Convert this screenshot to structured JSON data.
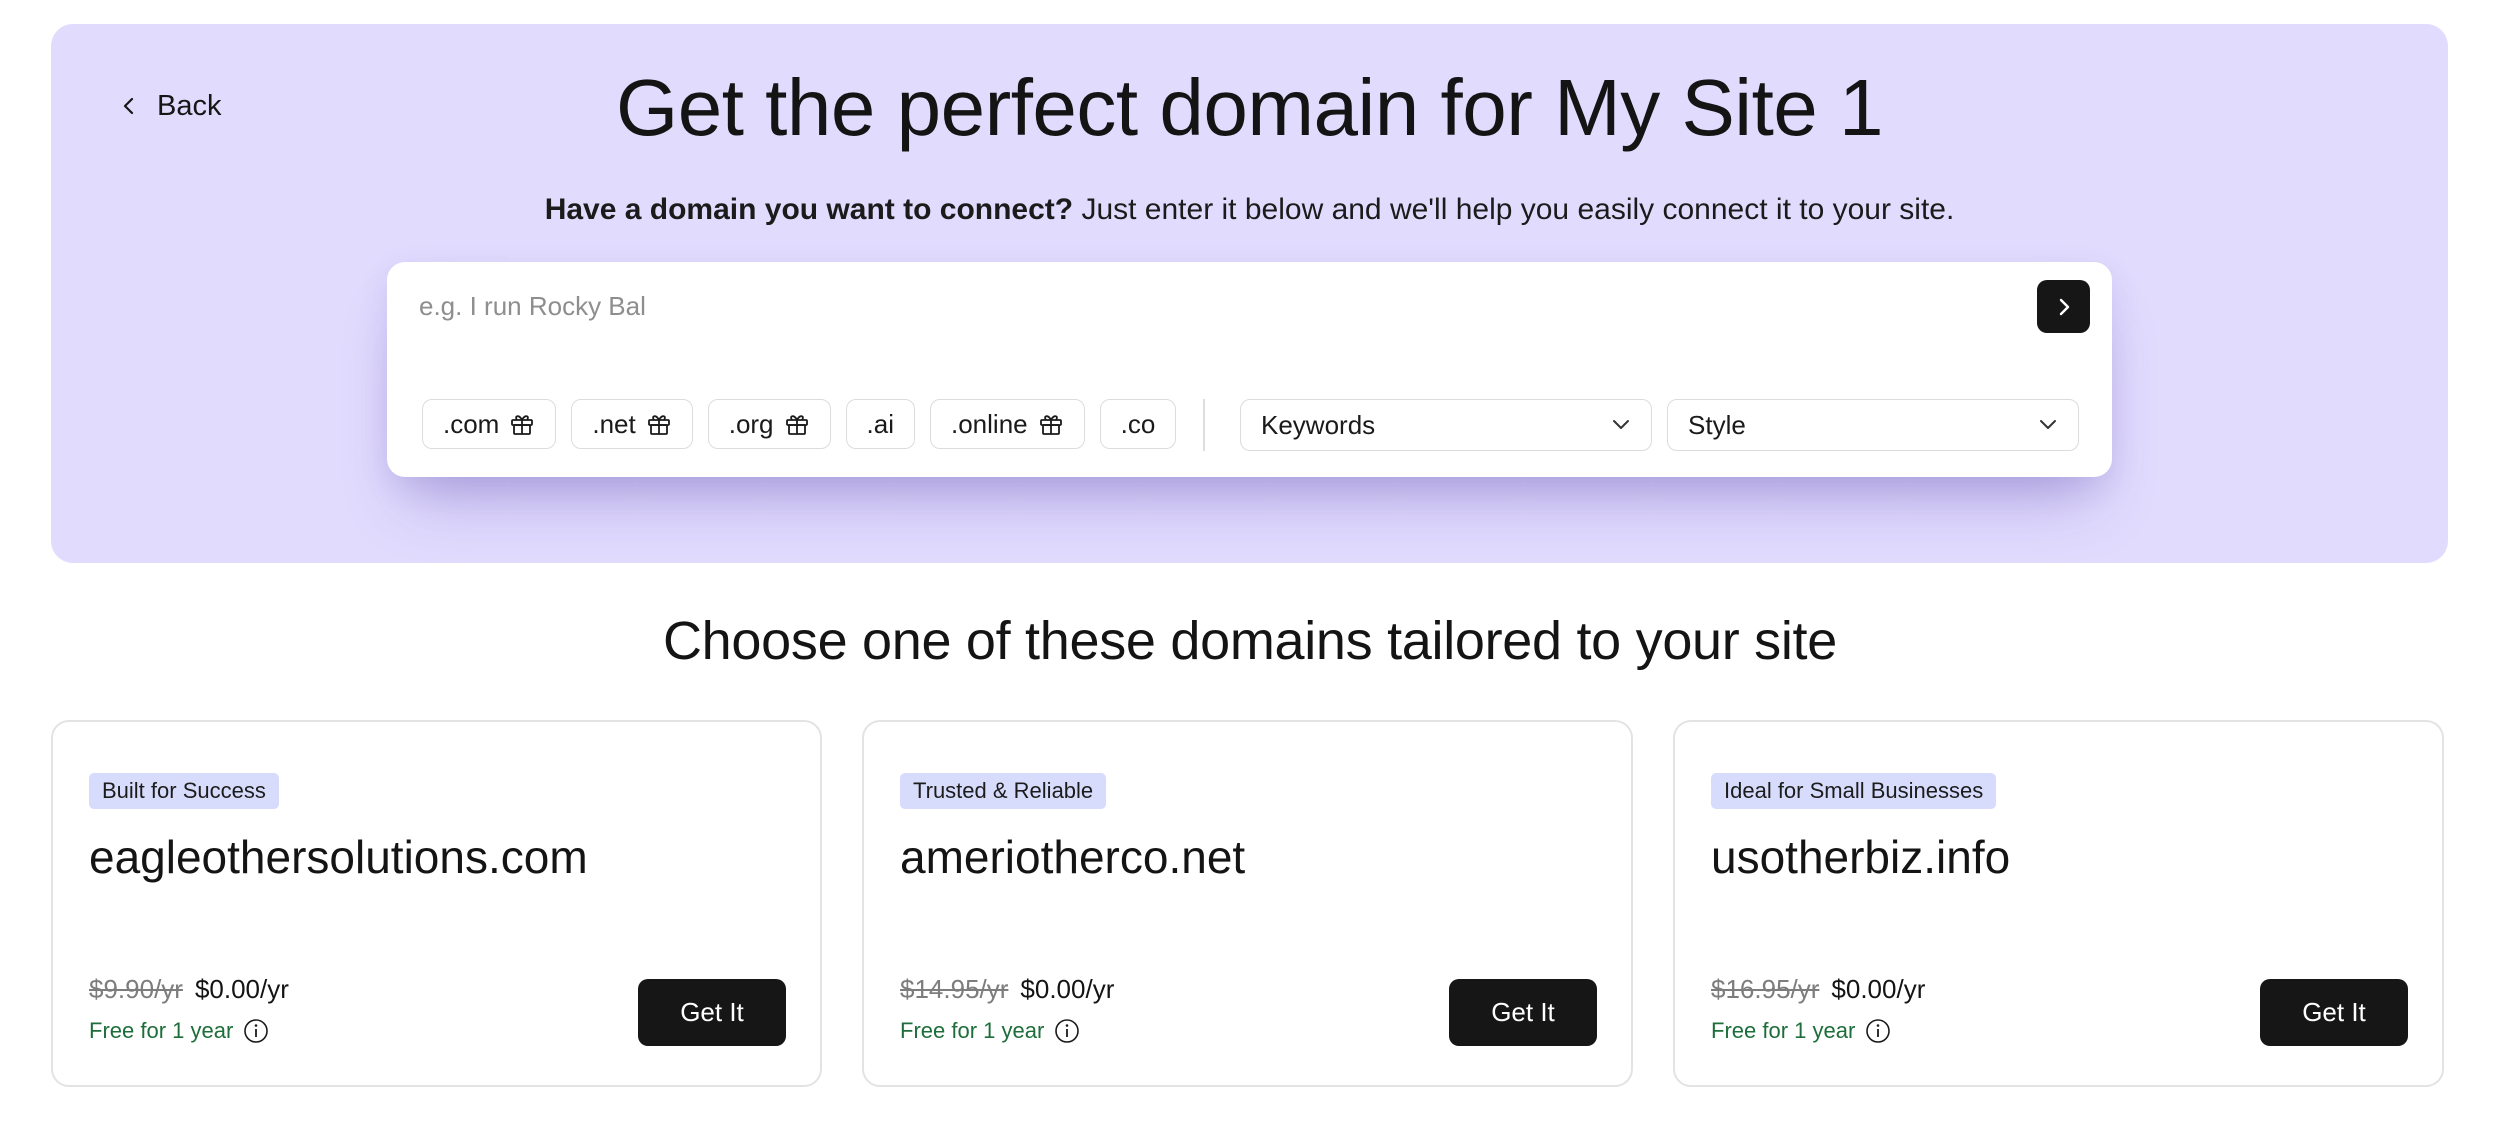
{
  "back": {
    "label": "Back"
  },
  "hero": {
    "title": "Get the perfect domain for My Site 1",
    "subtitle_bold": "Have a domain you want to connect?",
    "subtitle_rest": " Just enter it below and we'll help you easily connect it to your site."
  },
  "search": {
    "placeholder": "e.g. I run Rocky Bal",
    "value": ""
  },
  "tlds": [
    {
      "label": ".com",
      "gift": true
    },
    {
      "label": ".net",
      "gift": true
    },
    {
      "label": ".org",
      "gift": true
    },
    {
      "label": ".ai",
      "gift": false
    },
    {
      "label": ".online",
      "gift": true
    },
    {
      "label": ".co",
      "gift": false
    }
  ],
  "filters": {
    "keywords": "Keywords",
    "style": "Style"
  },
  "section_title": "Choose one of these domains tailored to your site",
  "cards": [
    {
      "badge": "Built for Success",
      "domain": "eagleothersolutions.com",
      "old_price": "$9.90/yr",
      "new_price": "$0.00/yr",
      "free": "Free for 1 year",
      "button": "Get It"
    },
    {
      "badge": "Trusted & Reliable",
      "domain": "ameriotherco.net",
      "old_price": "$14.95/yr",
      "new_price": "$0.00/yr",
      "free": "Free for 1 year",
      "button": "Get It"
    },
    {
      "badge": "Ideal for Small Businesses",
      "domain": "usotherbiz.info",
      "old_price": "$16.95/yr",
      "new_price": "$0.00/yr",
      "free": "Free for 1 year",
      "button": "Get It"
    }
  ],
  "icons": {
    "back": "chevron-left-icon",
    "submit": "chevron-right-icon",
    "gift": "gift-icon",
    "dropdown": "chevron-down-icon",
    "info": "info-icon"
  },
  "colors": {
    "hero_bg": "#e1dbfe",
    "badge_bg": "#d8dcfc",
    "button_bg": "#161616",
    "free_text": "#1d6e3a"
  }
}
